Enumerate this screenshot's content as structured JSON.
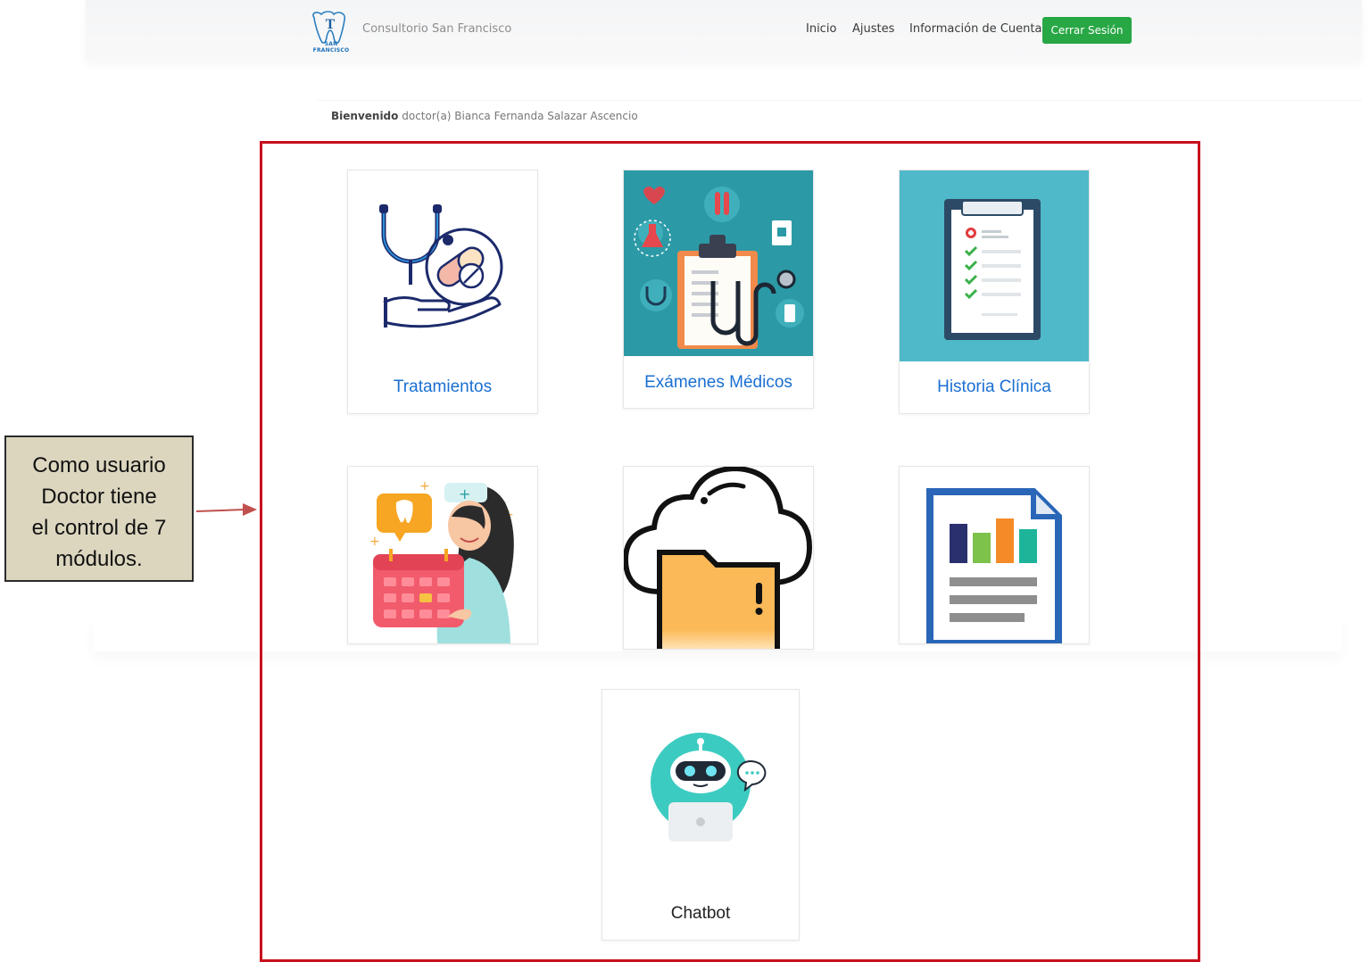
{
  "navbar": {
    "logo_letter": "T",
    "logo_caption": "SAN FRANCISCO",
    "brand": "Consultorio San Francisco",
    "links": [
      "Inicio",
      "Ajustes",
      "Información de Cuenta"
    ],
    "logout_label": "Cerrar Sesión",
    "logout_color": "#28a745"
  },
  "welcome": {
    "label": "Bienvenido",
    "user": "doctor(a) Bianca Fernanda Salazar Ascencio"
  },
  "modules": [
    {
      "title": "Tratamientos",
      "icon": "stethoscope-pill-hand-icon"
    },
    {
      "title": "Exámenes Médicos",
      "icon": "clipboard-stethoscope-icon"
    },
    {
      "title": "Historia Clínica",
      "icon": "clinical-checklist-icon"
    },
    {
      "title": "",
      "icon": "nurse-calendar-icon"
    },
    {
      "title": "",
      "icon": "cloud-folder-icon"
    },
    {
      "title": "",
      "icon": "report-bar-chart-icon"
    },
    {
      "title": "Chatbot",
      "icon": "robot-laptop-icon"
    }
  ],
  "callout": {
    "lines": [
      "Como usuario",
      "Doctor tiene",
      "el control de 7",
      "módulos."
    ]
  },
  "colors": {
    "highlight_border": "#c8101d",
    "title_blue": "#1a6fd1",
    "callout_bg": "#dcd6bf"
  }
}
